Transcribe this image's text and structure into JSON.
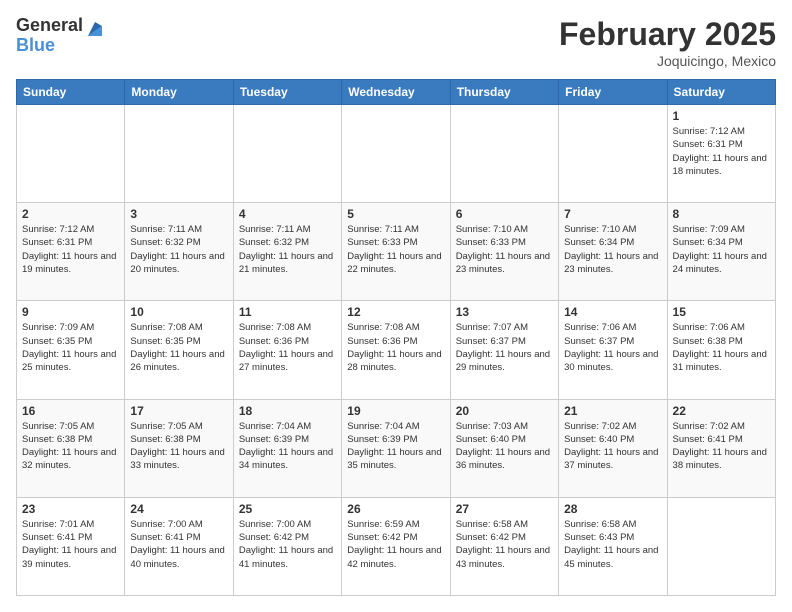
{
  "header": {
    "logo_general": "General",
    "logo_blue": "Blue",
    "title": "February 2025",
    "location": "Joquicingo, Mexico"
  },
  "days_of_week": [
    "Sunday",
    "Monday",
    "Tuesday",
    "Wednesday",
    "Thursday",
    "Friday",
    "Saturday"
  ],
  "weeks": [
    [
      {
        "day": "",
        "info": ""
      },
      {
        "day": "",
        "info": ""
      },
      {
        "day": "",
        "info": ""
      },
      {
        "day": "",
        "info": ""
      },
      {
        "day": "",
        "info": ""
      },
      {
        "day": "",
        "info": ""
      },
      {
        "day": "1",
        "info": "Sunrise: 7:12 AM\nSunset: 6:31 PM\nDaylight: 11 hours and 18 minutes."
      }
    ],
    [
      {
        "day": "2",
        "info": "Sunrise: 7:12 AM\nSunset: 6:31 PM\nDaylight: 11 hours and 19 minutes."
      },
      {
        "day": "3",
        "info": "Sunrise: 7:11 AM\nSunset: 6:32 PM\nDaylight: 11 hours and 20 minutes."
      },
      {
        "day": "4",
        "info": "Sunrise: 7:11 AM\nSunset: 6:32 PM\nDaylight: 11 hours and 21 minutes."
      },
      {
        "day": "5",
        "info": "Sunrise: 7:11 AM\nSunset: 6:33 PM\nDaylight: 11 hours and 22 minutes."
      },
      {
        "day": "6",
        "info": "Sunrise: 7:10 AM\nSunset: 6:33 PM\nDaylight: 11 hours and 23 minutes."
      },
      {
        "day": "7",
        "info": "Sunrise: 7:10 AM\nSunset: 6:34 PM\nDaylight: 11 hours and 23 minutes."
      },
      {
        "day": "8",
        "info": "Sunrise: 7:09 AM\nSunset: 6:34 PM\nDaylight: 11 hours and 24 minutes."
      }
    ],
    [
      {
        "day": "9",
        "info": "Sunrise: 7:09 AM\nSunset: 6:35 PM\nDaylight: 11 hours and 25 minutes."
      },
      {
        "day": "10",
        "info": "Sunrise: 7:08 AM\nSunset: 6:35 PM\nDaylight: 11 hours and 26 minutes."
      },
      {
        "day": "11",
        "info": "Sunrise: 7:08 AM\nSunset: 6:36 PM\nDaylight: 11 hours and 27 minutes."
      },
      {
        "day": "12",
        "info": "Sunrise: 7:08 AM\nSunset: 6:36 PM\nDaylight: 11 hours and 28 minutes."
      },
      {
        "day": "13",
        "info": "Sunrise: 7:07 AM\nSunset: 6:37 PM\nDaylight: 11 hours and 29 minutes."
      },
      {
        "day": "14",
        "info": "Sunrise: 7:06 AM\nSunset: 6:37 PM\nDaylight: 11 hours and 30 minutes."
      },
      {
        "day": "15",
        "info": "Sunrise: 7:06 AM\nSunset: 6:38 PM\nDaylight: 11 hours and 31 minutes."
      }
    ],
    [
      {
        "day": "16",
        "info": "Sunrise: 7:05 AM\nSunset: 6:38 PM\nDaylight: 11 hours and 32 minutes."
      },
      {
        "day": "17",
        "info": "Sunrise: 7:05 AM\nSunset: 6:38 PM\nDaylight: 11 hours and 33 minutes."
      },
      {
        "day": "18",
        "info": "Sunrise: 7:04 AM\nSunset: 6:39 PM\nDaylight: 11 hours and 34 minutes."
      },
      {
        "day": "19",
        "info": "Sunrise: 7:04 AM\nSunset: 6:39 PM\nDaylight: 11 hours and 35 minutes."
      },
      {
        "day": "20",
        "info": "Sunrise: 7:03 AM\nSunset: 6:40 PM\nDaylight: 11 hours and 36 minutes."
      },
      {
        "day": "21",
        "info": "Sunrise: 7:02 AM\nSunset: 6:40 PM\nDaylight: 11 hours and 37 minutes."
      },
      {
        "day": "22",
        "info": "Sunrise: 7:02 AM\nSunset: 6:41 PM\nDaylight: 11 hours and 38 minutes."
      }
    ],
    [
      {
        "day": "23",
        "info": "Sunrise: 7:01 AM\nSunset: 6:41 PM\nDaylight: 11 hours and 39 minutes."
      },
      {
        "day": "24",
        "info": "Sunrise: 7:00 AM\nSunset: 6:41 PM\nDaylight: 11 hours and 40 minutes."
      },
      {
        "day": "25",
        "info": "Sunrise: 7:00 AM\nSunset: 6:42 PM\nDaylight: 11 hours and 41 minutes."
      },
      {
        "day": "26",
        "info": "Sunrise: 6:59 AM\nSunset: 6:42 PM\nDaylight: 11 hours and 42 minutes."
      },
      {
        "day": "27",
        "info": "Sunrise: 6:58 AM\nSunset: 6:42 PM\nDaylight: 11 hours and 43 minutes."
      },
      {
        "day": "28",
        "info": "Sunrise: 6:58 AM\nSunset: 6:43 PM\nDaylight: 11 hours and 45 minutes."
      },
      {
        "day": "",
        "info": ""
      }
    ]
  ]
}
